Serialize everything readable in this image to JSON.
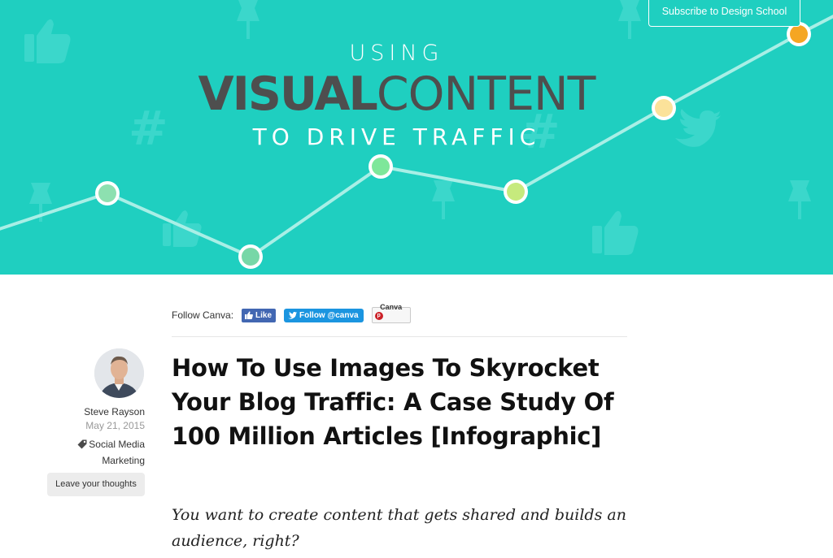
{
  "hero": {
    "line1": "USING",
    "line2_bold": "VISUAL",
    "line2_light": "CONTENT",
    "line3": "TO DRIVE TRAFFIC",
    "bg_color": "#1fcfc0",
    "chart_points": [
      "#8de0b0",
      "#77d7a7",
      "#7ee79a",
      "#c6ea7d",
      "#fbe29a",
      "#f5a623"
    ]
  },
  "header": {
    "subscribe_label": "Subscribe to Design School"
  },
  "follow": {
    "label": "Follow Canva:",
    "facebook_label": "Like",
    "twitter_label": "Follow @canva",
    "pinterest_label": "Canva"
  },
  "author": {
    "name": "Steve Rayson",
    "date": "May 21, 2015",
    "category": "Social Media Marketing",
    "leave_label": "Leave your thoughts"
  },
  "article": {
    "title": "How To Use Images To Skyrocket Your Blog Traffic: A Case Study Of 100 Million Articles [Infographic]",
    "lead": "You want to create content that gets shared and builds an audience, right?"
  }
}
